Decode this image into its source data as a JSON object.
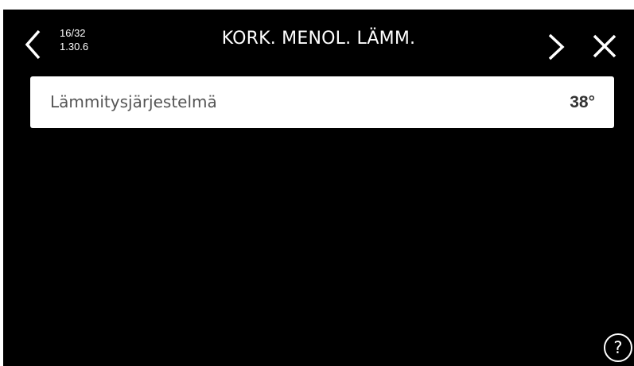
{
  "header": {
    "page_counter": "16/32",
    "menu_code": "1.30.6",
    "title": "KORK. MENOL. LÄMM.",
    "back_icon": "chevron-left-icon",
    "next_icon": "chevron-right-icon",
    "close_icon": "close-icon"
  },
  "settings": [
    {
      "label": "Lämmitysjärjestelmä",
      "value": "38°"
    }
  ],
  "help": {
    "glyph": "?",
    "icon": "help-icon"
  },
  "colors": {
    "background": "#000000",
    "row_background": "#ffffff",
    "row_label": "#555555",
    "row_value": "#333333",
    "foreground": "#ffffff"
  }
}
